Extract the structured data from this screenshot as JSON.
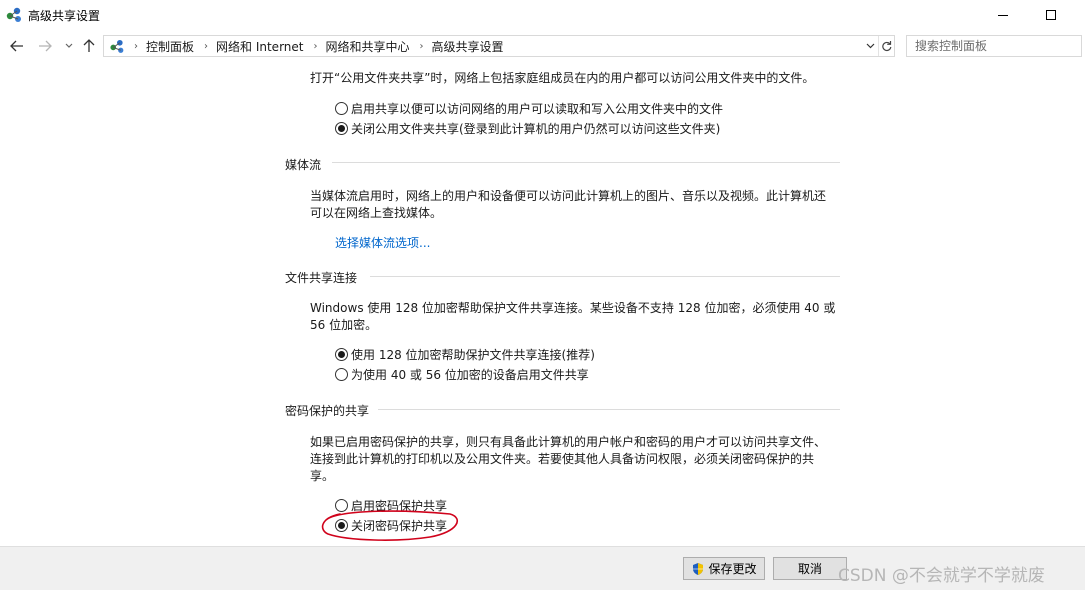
{
  "window": {
    "title": "高级共享设置",
    "app_icon": "network-sharing-icon"
  },
  "navigation": {
    "breadcrumbs": [
      "控制面板",
      "网络和 Internet",
      "网络和共享中心",
      "高级共享设置"
    ],
    "search_placeholder": "搜索控制面板"
  },
  "public_folder": {
    "description": "打开“公用文件夹共享”时，网络上包括家庭组成员在内的用户都可以访问公用文件夹中的文件。",
    "options": [
      {
        "label": "启用共享以便可以访问网络的用户可以读取和写入公用文件夹中的文件",
        "selected": false
      },
      {
        "label": "关闭公用文件夹共享(登录到此计算机的用户仍然可以访问这些文件夹)",
        "selected": true
      }
    ]
  },
  "media_streaming": {
    "header": "媒体流",
    "description_line1": "当媒体流启用时，网络上的用户和设备便可以访问此计算机上的图片、音乐以及视频。此计算机还",
    "description_line2": "可以在网络上查找媒体。",
    "link": "选择媒体流选项..."
  },
  "file_sharing": {
    "header": "文件共享连接",
    "description_line1": "Windows 使用 128 位加密帮助保护文件共享连接。某些设备不支持 128 位加密，必须使用 40 或",
    "description_line2": "56 位加密。",
    "options": [
      {
        "label": "使用 128 位加密帮助保护文件共享连接(推荐)",
        "selected": true
      },
      {
        "label": "为使用 40 或 56 位加密的设备启用文件共享",
        "selected": false
      }
    ]
  },
  "password_sharing": {
    "header": "密码保护的共享",
    "description_line1": "如果已启用密码保护的共享，则只有具备此计算机的用户帐户和密码的用户才可以访问共享文件、",
    "description_line2": "连接到此计算机的打印机以及公用文件夹。若要使其他人具备访问权限，必须关闭密码保护的共",
    "description_line3": "享。",
    "options": [
      {
        "label": "启用密码保护共享",
        "selected": false
      },
      {
        "label": "关闭密码保护共享",
        "selected": true
      }
    ]
  },
  "footer": {
    "save_label": "保存更改",
    "cancel_label": "取消",
    "watermark": "CSDN @不会就学不学就废"
  },
  "colors": {
    "link": "#0066cc",
    "highlight": "#d0021b",
    "footer_bg": "#f0f0f0"
  }
}
